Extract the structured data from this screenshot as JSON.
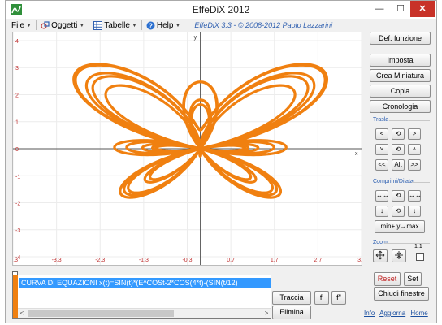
{
  "window": {
    "title": "EffeDiX 2012",
    "controls": {
      "minimize": "—",
      "maximize": "☐",
      "close": "✕"
    }
  },
  "menu": {
    "file": "File",
    "oggetti": "Oggetti",
    "tabelle": "Tabelle",
    "help": "Help",
    "copyright": "EffeDiX 3.3 - © 2008-2012 Paolo Lazzarini"
  },
  "plot": {
    "x_axis_label": "x",
    "y_axis_label": "y",
    "x_ticks": [
      "-4.3",
      "-3.3",
      "-2.3",
      "-1.3",
      "-0.3",
      "0.7",
      "1.7",
      "2.7",
      "3.7"
    ],
    "y_ticks": [
      "4",
      "3",
      "2",
      "1",
      "0",
      "-1",
      "-2",
      "-3",
      "-4"
    ],
    "curve_color": "#f08010",
    "axis_color": "#555555",
    "grid_color": "#ececec"
  },
  "side": {
    "def_funzione": "Def. funzione",
    "imposta": "Imposta",
    "crea_miniatura": "Crea Miniatura",
    "copia": "Copia",
    "cronologia": "Cronologia",
    "trasla_label": "Trasla",
    "trasla_buttons": [
      "<",
      "⟲",
      ">",
      "˅",
      "⟲",
      "˄",
      "<<",
      "Alt",
      ">>"
    ],
    "comprimi_label": "Comprimi/Dilata",
    "comprimi_buttons": [
      "↔↔",
      "⟲",
      "↔↔",
      "↕",
      "⟲",
      "↕"
    ],
    "min_max": "min+ y→max",
    "zoom_label": "Zoom",
    "zoom_ratio": "1:1"
  },
  "editor": {
    "line1": "CURVA DI EQUAZIONI x(t)=SIN(t)*(E^COSt-2*COS(4*t)-(SIN(t/12)"
  },
  "bottom": {
    "traccia": "Traccia",
    "f_prime": "f'",
    "f_second": "f\"",
    "elimina": "Elimina",
    "reset": "Reset",
    "set": "Set",
    "chiudi": "Chiudi finestre",
    "info": "Info",
    "aggiorna": "Aggiorna",
    "home": "Home"
  }
}
